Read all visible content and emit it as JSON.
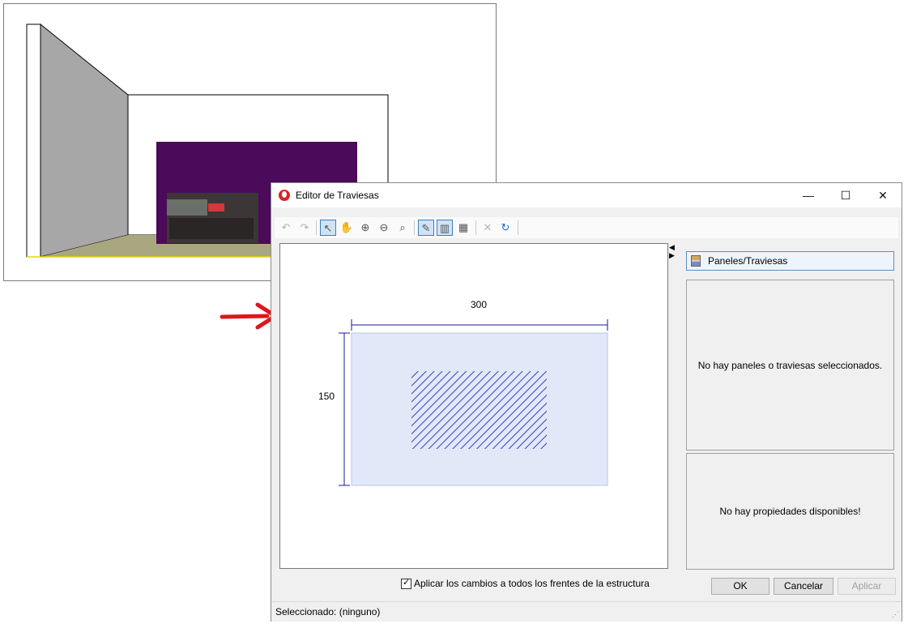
{
  "dialog": {
    "title": "Editor de Traviesas",
    "window_controls": {
      "minimize": "—",
      "maximize": "☐",
      "close": "✕"
    }
  },
  "toolbar": {
    "buttons": [
      {
        "name": "undo-icon",
        "glyph": "↶",
        "state": "disabled"
      },
      {
        "name": "redo-icon",
        "glyph": "↷",
        "state": "disabled"
      },
      {
        "name": "select-pointer-icon",
        "glyph": "↖",
        "state": "active"
      },
      {
        "name": "pan-hand-icon",
        "glyph": "✋",
        "state": "normal"
      },
      {
        "name": "zoom-in-icon",
        "glyph": "⊕",
        "state": "normal"
      },
      {
        "name": "zoom-out-icon",
        "glyph": "⊖",
        "state": "normal"
      },
      {
        "name": "zoom-extents-icon",
        "glyph": "⌕",
        "state": "normal"
      },
      {
        "name": "edit-traviesas-icon",
        "glyph": "✎",
        "state": "active"
      },
      {
        "name": "vertical-divisions-icon",
        "glyph": "▥",
        "state": "active"
      },
      {
        "name": "grid-divisions-icon",
        "glyph": "▦",
        "state": "normal"
      },
      {
        "name": "delete-icon",
        "glyph": "✕",
        "state": "disabled"
      },
      {
        "name": "refresh-icon",
        "glyph": "↻",
        "state": "normal"
      }
    ]
  },
  "canvas": {
    "width_dimension": "300",
    "height_dimension": "150"
  },
  "panel": {
    "header_label": "Paneles/Traviesas",
    "selection_message": "No hay paneles o traviesas seleccionados.",
    "properties_message": "No hay propiedades disponibles!"
  },
  "options": {
    "apply_all_label": "Aplicar los cambios a todos los frentes de la estructura",
    "apply_all_checked": true
  },
  "buttons": {
    "ok": "OK",
    "cancel": "Cancelar",
    "apply": "Aplicar"
  },
  "status": {
    "text": "Seleccionado: (ninguno)"
  },
  "colors": {
    "accent": "#3c7fc1",
    "dimension_line": "#1a1a9a",
    "panel_fill": "#e1e9f9",
    "hatch": "#2a2ab0",
    "wall_purple": "#4b0a5a",
    "arrow_red": "#e0161b"
  }
}
